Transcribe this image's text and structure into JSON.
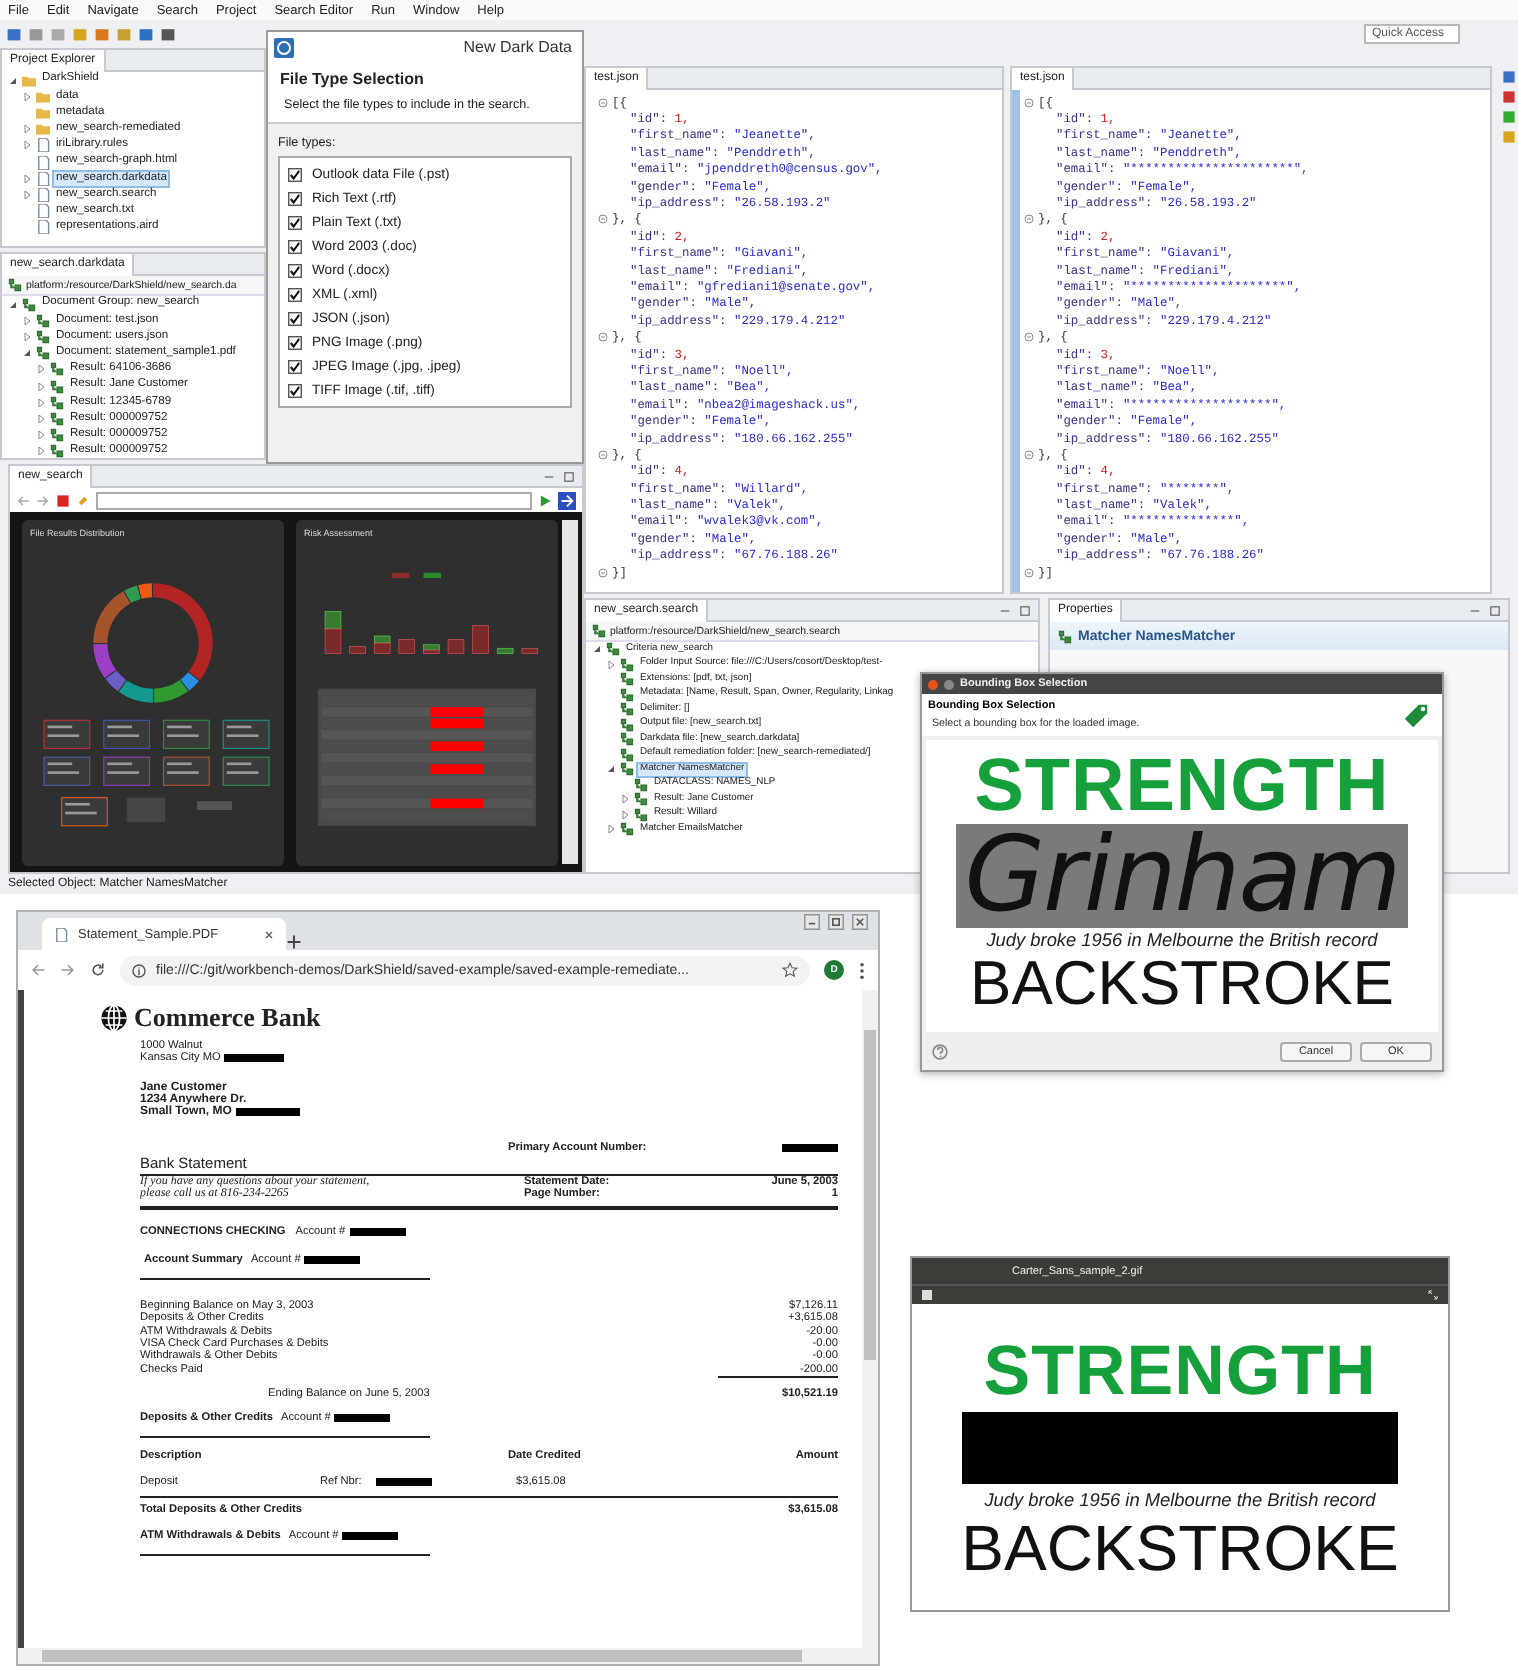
{
  "ide": {
    "menu": [
      "File",
      "Edit",
      "Navigate",
      "Search",
      "Project",
      "Search Editor",
      "Run",
      "Window",
      "Help"
    ],
    "quick_access": "Quick Access",
    "project_explorer": {
      "tab": "Project Explorer",
      "items": [
        {
          "label": "DarkShield",
          "kind": "folder",
          "expanded": true,
          "selected": false,
          "children": [
            {
              "label": "data",
              "kind": "folder",
              "expanded": false,
              "selected": false
            },
            {
              "label": "metadata",
              "kind": "folder",
              "selected": false
            },
            {
              "label": "new_search-remediated",
              "kind": "folder",
              "expanded": false,
              "selected": false
            },
            {
              "label": "iriLibrary.rules",
              "kind": "file",
              "expanded": false,
              "selected": false
            },
            {
              "label": "new_search-graph.html",
              "kind": "file",
              "selected": false
            },
            {
              "label": "new_search.darkdata",
              "kind": "file",
              "expanded": false,
              "selected": true
            },
            {
              "label": "new_search.search",
              "kind": "file",
              "expanded": false,
              "selected": false
            },
            {
              "label": "new_search.txt",
              "kind": "file",
              "selected": false
            },
            {
              "label": "representations.aird",
              "kind": "file",
              "selected": false
            }
          ]
        }
      ]
    },
    "darkdata": {
      "tab": "new_search.darkdata",
      "path": "platform:/resource/DarkShield/new_search.da",
      "items": [
        {
          "label": "Document Group: new_search",
          "kind": "node",
          "expanded": true,
          "children": [
            {
              "label": "Document: test.json",
              "kind": "node",
              "expanded": false
            },
            {
              "label": "Document: users.json",
              "kind": "node",
              "expanded": false
            },
            {
              "label": "Document: statement_sample1.pdf",
              "kind": "node",
              "expanded": true,
              "children": [
                {
                  "label": "Result: 64106-3686",
                  "kind": "node",
                  "expanded": false
                },
                {
                  "label": "Result: Jane Customer",
                  "kind": "node",
                  "expanded": false
                },
                {
                  "label": "Result: 12345-6789",
                  "kind": "node",
                  "expanded": false
                },
                {
                  "label": "Result: 000009752",
                  "kind": "node",
                  "expanded": false
                },
                {
                  "label": "Result: 000009752",
                  "kind": "node",
                  "expanded": false
                },
                {
                  "label": "Result: 000009752",
                  "kind": "node",
                  "expanded": false
                }
              ]
            }
          ]
        }
      ]
    },
    "dialog": {
      "title": "New Dark Data",
      "heading": "File Type Selection",
      "description": "Select the file types to include in the search.",
      "list_label": "File types:",
      "file_types": [
        {
          "label": "Outlook data File (.pst)",
          "checked": true
        },
        {
          "label": "Rich Text (.rtf)",
          "checked": true
        },
        {
          "label": "Plain Text (.txt)",
          "checked": true
        },
        {
          "label": "Word 2003 (.doc)",
          "checked": true
        },
        {
          "label": "Word (.docx)",
          "checked": true
        },
        {
          "label": "XML (.xml)",
          "checked": true
        },
        {
          "label": "JSON (.json)",
          "checked": true
        },
        {
          "label": "PNG Image (.png)",
          "checked": true
        },
        {
          "label": "JPEG Image (.jpg, .jpeg)",
          "checked": true
        },
        {
          "label": "TIFF Image (.tif, .tiff)",
          "checked": true
        }
      ]
    },
    "editors": [
      {
        "tab": "test.json",
        "lines": [
          {
            "kind": "bracket",
            "text": "[{"
          },
          {
            "kind": "number",
            "key": "\"id\":",
            "value": "1,"
          },
          {
            "kind": "string",
            "key": "\"first_name\":",
            "value": "\"Jeanette\","
          },
          {
            "kind": "string",
            "key": "\"last_name\":",
            "value": "\"Penddreth\","
          },
          {
            "kind": "string",
            "key": "\"email\":",
            "value": "\"jpenddreth0@census.gov\","
          },
          {
            "kind": "string",
            "key": "\"gender\":",
            "value": "\"Female\","
          },
          {
            "kind": "string",
            "key": "\"ip_address\":",
            "value": "\"26.58.193.2\""
          },
          {
            "kind": "bracket",
            "text": "}, {"
          },
          {
            "kind": "number",
            "key": "\"id\":",
            "value": "2,"
          },
          {
            "kind": "string",
            "key": "\"first_name\":",
            "value": "\"Giavani\","
          },
          {
            "kind": "string",
            "key": "\"last_name\":",
            "value": "\"Frediani\","
          },
          {
            "kind": "string",
            "key": "\"email\":",
            "value": "\"gfrediani1@senate.gov\","
          },
          {
            "kind": "string",
            "key": "\"gender\":",
            "value": "\"Male\","
          },
          {
            "kind": "string",
            "key": "\"ip_address\":",
            "value": "\"229.179.4.212\""
          },
          {
            "kind": "bracket",
            "text": "}, {"
          },
          {
            "kind": "number",
            "key": "\"id\":",
            "value": "3,"
          },
          {
            "kind": "string",
            "key": "\"first_name\":",
            "value": "\"Noell\","
          },
          {
            "kind": "string",
            "key": "\"last_name\":",
            "value": "\"Bea\","
          },
          {
            "kind": "string",
            "key": "\"email\":",
            "value": "\"nbea2@imageshack.us\","
          },
          {
            "kind": "string",
            "key": "\"gender\":",
            "value": "\"Female\","
          },
          {
            "kind": "string",
            "key": "\"ip_address\":",
            "value": "\"180.66.162.255\""
          },
          {
            "kind": "bracket",
            "text": "}, {"
          },
          {
            "kind": "number",
            "key": "\"id\":",
            "value": "4,"
          },
          {
            "kind": "string",
            "key": "\"first_name\":",
            "value": "\"Willard\","
          },
          {
            "kind": "string",
            "key": "\"last_name\":",
            "value": "\"Valek\","
          },
          {
            "kind": "string",
            "key": "\"email\":",
            "value": "\"wvalek3@vk.com\","
          },
          {
            "kind": "string",
            "key": "\"gender\":",
            "value": "\"Male\","
          },
          {
            "kind": "string",
            "key": "\"ip_address\":",
            "value": "\"67.76.188.26\""
          },
          {
            "kind": "bracket",
            "text": "}]"
          }
        ]
      },
      {
        "tab": "test.json",
        "lines": [
          {
            "kind": "bracket",
            "text": "[{"
          },
          {
            "kind": "number",
            "key": "\"id\":",
            "value": "1,"
          },
          {
            "kind": "string",
            "key": "\"first_name\":",
            "value": "\"Jeanette\","
          },
          {
            "kind": "string",
            "key": "\"last_name\":",
            "value": "\"Penddreth\","
          },
          {
            "kind": "string",
            "key": "\"email\":",
            "value": "\"**********************\","
          },
          {
            "kind": "string",
            "key": "\"gender\":",
            "value": "\"Female\","
          },
          {
            "kind": "string",
            "key": "\"ip_address\":",
            "value": "\"26.58.193.2\""
          },
          {
            "kind": "bracket",
            "text": "}, {"
          },
          {
            "kind": "number",
            "key": "\"id\":",
            "value": "2,"
          },
          {
            "kind": "string",
            "key": "\"first_name\":",
            "value": "\"Giavani\","
          },
          {
            "kind": "string",
            "key": "\"last_name\":",
            "value": "\"Frediani\","
          },
          {
            "kind": "string",
            "key": "\"email\":",
            "value": "\"*********************\","
          },
          {
            "kind": "string",
            "key": "\"gender\":",
            "value": "\"Male\","
          },
          {
            "kind": "string",
            "key": "\"ip_address\":",
            "value": "\"229.179.4.212\""
          },
          {
            "kind": "bracket",
            "text": "}, {"
          },
          {
            "kind": "number",
            "key": "\"id\":",
            "value": "3,"
          },
          {
            "kind": "string",
            "key": "\"first_name\":",
            "value": "\"Noell\","
          },
          {
            "kind": "string",
            "key": "\"last_name\":",
            "value": "\"Bea\","
          },
          {
            "kind": "string",
            "key": "\"email\":",
            "value": "\"*******************\","
          },
          {
            "kind": "string",
            "key": "\"gender\":",
            "value": "\"Female\","
          },
          {
            "kind": "string",
            "key": "\"ip_address\":",
            "value": "\"180.66.162.255\""
          },
          {
            "kind": "bracket",
            "text": "}, {"
          },
          {
            "kind": "number",
            "key": "\"id\":",
            "value": "4,"
          },
          {
            "kind": "string",
            "key": "\"first_name\":",
            "value": "\"*******\","
          },
          {
            "kind": "string",
            "key": "\"last_name\":",
            "value": "\"Valek\","
          },
          {
            "kind": "string",
            "key": "\"email\":",
            "value": "\"**************\","
          },
          {
            "kind": "string",
            "key": "\"gender\":",
            "value": "\"Male\","
          },
          {
            "kind": "string",
            "key": "\"ip_address\":",
            "value": "\"67.76.188.26\""
          },
          {
            "kind": "bracket",
            "text": "}]"
          }
        ]
      }
    ],
    "browser": {
      "tab": "new_search",
      "cards": [
        {
          "title": "File Results Distribution",
          "kind": "donut"
        },
        {
          "title": "Risk Assessment",
          "kind": "bars"
        }
      ]
    },
    "search_editor": {
      "tab": "new_search.search",
      "path": "platform:/resource/DarkShield/new_search.search",
      "items": [
        {
          "label": "Criteria new_search",
          "kind": "node",
          "expanded": true,
          "selected": false,
          "children": [
            {
              "label": "Folder Input Source: file:///C:/Users/cosort/Desktop/test-",
              "kind": "node",
              "expanded": false,
              "selected": false
            },
            {
              "label": "Extensions: [pdf, txt, json]",
              "kind": "node",
              "selected": false
            },
            {
              "label": "Metadata: [Name, Result, Span, Owner, Regularity, Linkag",
              "kind": "node",
              "selected": false
            },
            {
              "label": "Delimiter: []",
              "kind": "node",
              "selected": false
            },
            {
              "label": "Output file: [new_search.txt]",
              "kind": "node",
              "selected": false
            },
            {
              "label": "Darkdata file: [new_search.darkdata]",
              "kind": "node",
              "selected": false
            },
            {
              "label": "Default remediation folder: [new_search-remediated/]",
              "kind": "node",
              "selected": false
            },
            {
              "label": "Matcher NamesMatcher",
              "kind": "node",
              "expanded": true,
              "selected": true,
              "children": [
                {
                  "label": "DATACLASS: NAMES_NLP",
                  "kind": "node",
                  "selected": false
                },
                {
                  "label": "Result: Jane Customer",
                  "kind": "node",
                  "expanded": false,
                  "selected": false
                },
                {
                  "label": "Result: Willard",
                  "kind": "node",
                  "expanded": false,
                  "selected": false
                }
              ]
            },
            {
              "label": "Matcher EmailsMatcher",
              "kind": "node",
              "expanded": false,
              "selected": false
            }
          ]
        }
      ]
    },
    "properties": {
      "tab": "Properties",
      "header": "Matcher NamesMatcher"
    },
    "status": "Selected Object: Matcher NamesMatcher"
  },
  "bbox_dialog": {
    "title": "Bounding Box Selection",
    "heading": "Bounding Box Selection",
    "description": "Select a bounding box for the loaded image.",
    "image": [
      {
        "kind": "headline",
        "text": "STRENGTH"
      },
      {
        "kind": "highlighted",
        "text": "Grinham"
      },
      {
        "kind": "caption",
        "text": "Judy broke 1956 in Melbourne the British record"
      },
      {
        "kind": "display",
        "text": "BACKSTROKE"
      }
    ],
    "buttons": [
      "Cancel",
      "OK"
    ]
  },
  "pdf_browser": {
    "tab": "Statement_Sample.PDF",
    "url": "file:///C:/git/workbench-demos/DarkShield/saved-example/saved-example-remediate...",
    "avatar": "D",
    "pdf": {
      "bank": "Commerce Bank",
      "bank_address": [
        {
          "text": "1000 Walnut",
          "redacted": false
        },
        {
          "text": "Kansas City MO",
          "redacted": true
        }
      ],
      "customer": [
        {
          "text": "Jane Customer",
          "redacted": false
        },
        {
          "text": "1234 Anywhere Dr.",
          "redacted": false
        },
        {
          "text": "Small Town, MO",
          "redacted": true
        }
      ],
      "primary_account": "Primary Account Number:",
      "title": "Bank Statement",
      "note": [
        "If you have any questions about your statement,",
        "please call us at 816-234-2265"
      ],
      "meta": [
        {
          "label": "Statement Date:",
          "value": "June 5, 2003"
        },
        {
          "label": "Page Number:",
          "value": "1"
        }
      ],
      "checking": {
        "label": "CONNECTIONS CHECKING",
        "account": "Account #"
      },
      "summary": {
        "label": "Account Summary",
        "account": "Account #",
        "rows": [
          {
            "label": "Beginning Balance on May 3, 2003",
            "amount": "$7,126.11"
          },
          {
            "label": "Deposits & Other Credits",
            "amount": "+3,615.08"
          },
          {
            "label": "ATM Withdrawals & Debits",
            "amount": "-20.00"
          },
          {
            "label": "VISA Check Card Purchases & Debits",
            "amount": "-0.00"
          },
          {
            "label": "Withdrawals & Other Debits",
            "amount": "-0.00"
          },
          {
            "label": "Checks Paid",
            "amount": "-200.00"
          }
        ],
        "ending_label": "Ending Balance on June 5, 2003",
        "ending_amount": "$10,521.19"
      },
      "deposits": {
        "label": "Deposits & Other Credits",
        "account": "Account #",
        "columns": [
          "Description",
          "Date Credited",
          "Amount"
        ],
        "rows": [
          {
            "description": "Deposit",
            "ref_label": "Ref Nbr:",
            "date_credited": "$3,615.08"
          }
        ],
        "total_label": "Total Deposits & Other Credits",
        "total": "$3,615.08"
      },
      "atm": {
        "label": "ATM Withdrawals & Debits",
        "account": "Account #"
      }
    }
  },
  "image_viewer": {
    "title": "Carter_Sans_sample_2.gif",
    "image": [
      {
        "kind": "headline",
        "text": "STRENGTH"
      },
      {
        "kind": "redacted"
      },
      {
        "kind": "caption",
        "text": "Judy broke 1956 in Melbourne the British record"
      },
      {
        "kind": "display",
        "text": "BACKSTROKE"
      }
    ]
  }
}
